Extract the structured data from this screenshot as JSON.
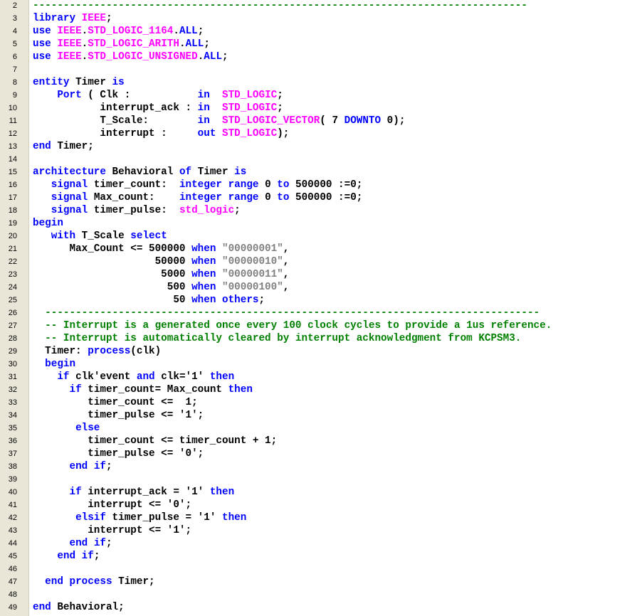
{
  "editor": {
    "colors": {
      "keyword": "#0000ff",
      "type": "#ff00ff",
      "comment": "#008000",
      "string": "#808080",
      "text": "#000000",
      "gutter": "#e9e6d8"
    },
    "lines": [
      {
        "num": "2",
        "tokens": [
          [
            "cm",
            "---------------------------------------------------------------------------------"
          ]
        ]
      },
      {
        "num": "3",
        "tokens": [
          [
            "kw",
            "library"
          ],
          [
            "",
            " "
          ],
          [
            "ty",
            "IEEE"
          ],
          [
            "",
            ";"
          ]
        ]
      },
      {
        "num": "4",
        "tokens": [
          [
            "kw",
            "use"
          ],
          [
            "",
            " "
          ],
          [
            "ty",
            "IEEE"
          ],
          [
            "",
            "."
          ],
          [
            "ty",
            "STD_LOGIC_1164"
          ],
          [
            "",
            "."
          ],
          [
            "kw",
            "ALL"
          ],
          [
            "",
            ";"
          ]
        ]
      },
      {
        "num": "5",
        "tokens": [
          [
            "kw",
            "use"
          ],
          [
            "",
            " "
          ],
          [
            "ty",
            "IEEE"
          ],
          [
            "",
            "."
          ],
          [
            "ty",
            "STD_LOGIC_ARITH"
          ],
          [
            "",
            "."
          ],
          [
            "kw",
            "ALL"
          ],
          [
            "",
            ";"
          ]
        ]
      },
      {
        "num": "6",
        "tokens": [
          [
            "kw",
            "use"
          ],
          [
            "",
            " "
          ],
          [
            "ty",
            "IEEE"
          ],
          [
            "",
            "."
          ],
          [
            "ty",
            "STD_LOGIC_UNSIGNED"
          ],
          [
            "",
            "."
          ],
          [
            "kw",
            "ALL"
          ],
          [
            "",
            ";"
          ]
        ]
      },
      {
        "num": "7",
        "tokens": []
      },
      {
        "num": "8",
        "tokens": [
          [
            "kw",
            "entity"
          ],
          [
            "",
            " Timer "
          ],
          [
            "kw",
            "is"
          ]
        ]
      },
      {
        "num": "9",
        "tokens": [
          [
            "",
            "    "
          ],
          [
            "kw",
            "Port"
          ],
          [
            "",
            " ( Clk :           "
          ],
          [
            "kw",
            "in"
          ],
          [
            "",
            "  "
          ],
          [
            "ty",
            "STD_LOGIC"
          ],
          [
            "",
            ";"
          ]
        ]
      },
      {
        "num": "10",
        "tokens": [
          [
            "",
            "           interrupt_ack : "
          ],
          [
            "kw",
            "in"
          ],
          [
            "",
            "  "
          ],
          [
            "ty",
            "STD_LOGIC"
          ],
          [
            "",
            ";"
          ]
        ]
      },
      {
        "num": "11",
        "tokens": [
          [
            "",
            "           T_Scale:        "
          ],
          [
            "kw",
            "in"
          ],
          [
            "",
            "  "
          ],
          [
            "ty",
            "STD_LOGIC_VECTOR"
          ],
          [
            "",
            "( 7 "
          ],
          [
            "kw",
            "DOWNTO"
          ],
          [
            "",
            " 0);"
          ]
        ]
      },
      {
        "num": "12",
        "tokens": [
          [
            "",
            "           interrupt :     "
          ],
          [
            "kw",
            "out"
          ],
          [
            "",
            " "
          ],
          [
            "ty",
            "STD_LOGIC"
          ],
          [
            "",
            ");"
          ]
        ]
      },
      {
        "num": "13",
        "tokens": [
          [
            "kw",
            "end"
          ],
          [
            "",
            " Timer;"
          ]
        ]
      },
      {
        "num": "14",
        "tokens": []
      },
      {
        "num": "15",
        "tokens": [
          [
            "kw",
            "architecture"
          ],
          [
            "",
            " Behavioral "
          ],
          [
            "kw",
            "of"
          ],
          [
            "",
            " Timer "
          ],
          [
            "kw",
            "is"
          ]
        ]
      },
      {
        "num": "16",
        "tokens": [
          [
            "",
            "   "
          ],
          [
            "kw",
            "signal"
          ],
          [
            "",
            " timer_count:  "
          ],
          [
            "kw",
            "integer"
          ],
          [
            "",
            " "
          ],
          [
            "kw",
            "range"
          ],
          [
            "",
            " 0 "
          ],
          [
            "kw",
            "to"
          ],
          [
            "",
            " 500000 :=0;"
          ]
        ]
      },
      {
        "num": "17",
        "tokens": [
          [
            "",
            "   "
          ],
          [
            "kw",
            "signal"
          ],
          [
            "",
            " Max_count:    "
          ],
          [
            "kw",
            "integer"
          ],
          [
            "",
            " "
          ],
          [
            "kw",
            "range"
          ],
          [
            "",
            " 0 "
          ],
          [
            "kw",
            "to"
          ],
          [
            "",
            " 500000 :=0;"
          ]
        ]
      },
      {
        "num": "18",
        "tokens": [
          [
            "",
            "   "
          ],
          [
            "kw",
            "signal"
          ],
          [
            "",
            " timer_pulse:  "
          ],
          [
            "ty",
            "std_logic"
          ],
          [
            "",
            ";"
          ]
        ]
      },
      {
        "num": "19",
        "tokens": [
          [
            "kw",
            "begin"
          ]
        ]
      },
      {
        "num": "20",
        "tokens": [
          [
            "",
            "   "
          ],
          [
            "kw",
            "with"
          ],
          [
            "",
            " T_Scale "
          ],
          [
            "kw",
            "select"
          ]
        ]
      },
      {
        "num": "21",
        "tokens": [
          [
            "",
            "      Max_Count <= 500000 "
          ],
          [
            "kw",
            "when"
          ],
          [
            "",
            " "
          ],
          [
            "st",
            "\"00000001\""
          ],
          [
            "",
            ","
          ]
        ]
      },
      {
        "num": "22",
        "tokens": [
          [
            "",
            "                    50000 "
          ],
          [
            "kw",
            "when"
          ],
          [
            "",
            " "
          ],
          [
            "st",
            "\"00000010\""
          ],
          [
            "",
            ","
          ]
        ]
      },
      {
        "num": "23",
        "tokens": [
          [
            "",
            "                     5000 "
          ],
          [
            "kw",
            "when"
          ],
          [
            "",
            " "
          ],
          [
            "st",
            "\"00000011\""
          ],
          [
            "",
            ","
          ]
        ]
      },
      {
        "num": "24",
        "tokens": [
          [
            "",
            "                      500 "
          ],
          [
            "kw",
            "when"
          ],
          [
            "",
            " "
          ],
          [
            "st",
            "\"00000100\""
          ],
          [
            "",
            ","
          ]
        ]
      },
      {
        "num": "25",
        "tokens": [
          [
            "",
            "                       50 "
          ],
          [
            "kw",
            "when"
          ],
          [
            "",
            " "
          ],
          [
            "kw",
            "others"
          ],
          [
            "",
            ";"
          ]
        ]
      },
      {
        "num": "26",
        "tokens": [
          [
            "",
            "  "
          ],
          [
            "cm",
            "---------------------------------------------------------------------------------"
          ]
        ]
      },
      {
        "num": "27",
        "tokens": [
          [
            "",
            "  "
          ],
          [
            "cm",
            "-- Interrupt is a generated once every 100 clock cycles to provide a 1us reference."
          ]
        ]
      },
      {
        "num": "28",
        "tokens": [
          [
            "",
            "  "
          ],
          [
            "cm",
            "-- Interrupt is automatically cleared by interrupt acknowledgment from KCPSM3."
          ]
        ]
      },
      {
        "num": "29",
        "tokens": [
          [
            "",
            "  Timer: "
          ],
          [
            "kw",
            "process"
          ],
          [
            "",
            "(clk)"
          ]
        ]
      },
      {
        "num": "30",
        "tokens": [
          [
            "",
            "  "
          ],
          [
            "kw",
            "begin"
          ]
        ]
      },
      {
        "num": "31",
        "tokens": [
          [
            "",
            "    "
          ],
          [
            "kw",
            "if"
          ],
          [
            "",
            " clk'event "
          ],
          [
            "kw",
            "and"
          ],
          [
            "",
            " clk='1' "
          ],
          [
            "kw",
            "then"
          ]
        ]
      },
      {
        "num": "32",
        "tokens": [
          [
            "",
            "      "
          ],
          [
            "kw",
            "if"
          ],
          [
            "",
            " timer_count= Max_count "
          ],
          [
            "kw",
            "then"
          ]
        ]
      },
      {
        "num": "33",
        "tokens": [
          [
            "",
            "         timer_count <=  1;"
          ]
        ]
      },
      {
        "num": "34",
        "tokens": [
          [
            "",
            "         timer_pulse <= '1';"
          ]
        ]
      },
      {
        "num": "35",
        "tokens": [
          [
            "",
            "       "
          ],
          [
            "kw",
            "else"
          ]
        ]
      },
      {
        "num": "36",
        "tokens": [
          [
            "",
            "         timer_count <= timer_count + 1;"
          ]
        ]
      },
      {
        "num": "37",
        "tokens": [
          [
            "",
            "         timer_pulse <= '0';"
          ]
        ]
      },
      {
        "num": "38",
        "tokens": [
          [
            "",
            "      "
          ],
          [
            "kw",
            "end"
          ],
          [
            "",
            " "
          ],
          [
            "kw",
            "if"
          ],
          [
            "",
            ";"
          ]
        ]
      },
      {
        "num": "39",
        "tokens": []
      },
      {
        "num": "40",
        "tokens": [
          [
            "",
            "      "
          ],
          [
            "kw",
            "if"
          ],
          [
            "",
            " interrupt_ack = '1' "
          ],
          [
            "kw",
            "then"
          ]
        ]
      },
      {
        "num": "41",
        "tokens": [
          [
            "",
            "         interrupt <= '0';"
          ]
        ]
      },
      {
        "num": "42",
        "tokens": [
          [
            "",
            "       "
          ],
          [
            "kw",
            "elsif"
          ],
          [
            "",
            " timer_pulse = '1' "
          ],
          [
            "kw",
            "then"
          ]
        ]
      },
      {
        "num": "43",
        "tokens": [
          [
            "",
            "         interrupt <= '1';"
          ]
        ]
      },
      {
        "num": "44",
        "tokens": [
          [
            "",
            "      "
          ],
          [
            "kw",
            "end"
          ],
          [
            "",
            " "
          ],
          [
            "kw",
            "if"
          ],
          [
            "",
            ";"
          ]
        ]
      },
      {
        "num": "45",
        "tokens": [
          [
            "",
            "    "
          ],
          [
            "kw",
            "end"
          ],
          [
            "",
            " "
          ],
          [
            "kw",
            "if"
          ],
          [
            "",
            ";"
          ]
        ]
      },
      {
        "num": "46",
        "tokens": []
      },
      {
        "num": "47",
        "tokens": [
          [
            "",
            "  "
          ],
          [
            "kw",
            "end"
          ],
          [
            "",
            " "
          ],
          [
            "kw",
            "process"
          ],
          [
            "",
            " Timer;"
          ]
        ]
      },
      {
        "num": "48",
        "tokens": []
      },
      {
        "num": "49",
        "tokens": [
          [
            "kw",
            "end"
          ],
          [
            "",
            " Behavioral;"
          ]
        ]
      }
    ]
  }
}
